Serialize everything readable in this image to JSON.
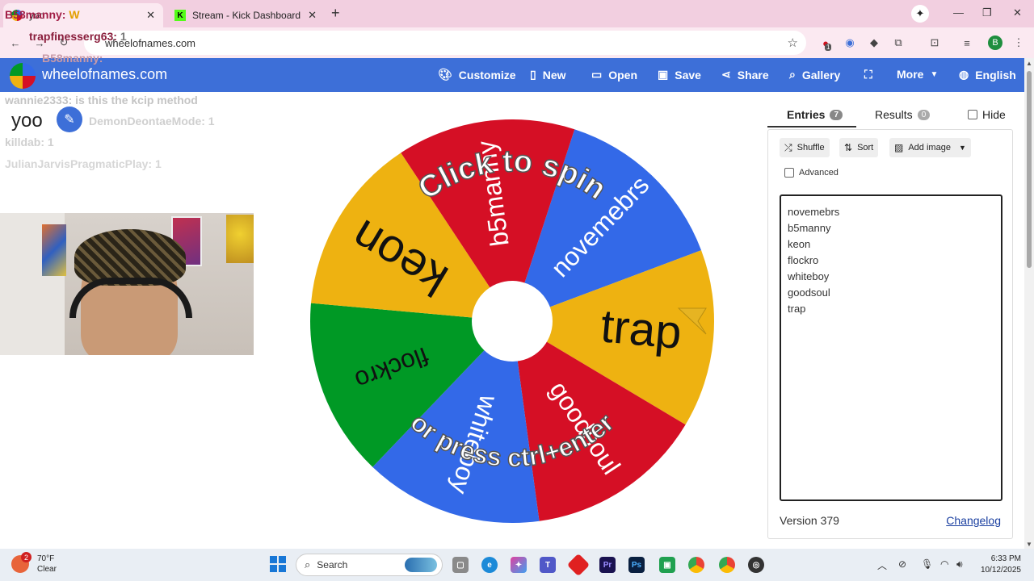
{
  "browser": {
    "tabs": [
      {
        "title": "yoo"
      },
      {
        "title": "Stream - Kick Dashboard"
      }
    ],
    "new_tab": "+",
    "url": "wheelofnames.com",
    "profile_initial": "B",
    "extension_badge": "1",
    "window_controls": {
      "minimize": "—",
      "maximize": "❐",
      "close": "✕"
    }
  },
  "site": {
    "title": "wheelofnames.com",
    "menu": [
      {
        "label": "Customize",
        "icon": "palette-icon"
      },
      {
        "label": "New",
        "icon": "file-icon"
      },
      {
        "label": "Open",
        "icon": "folder-icon"
      },
      {
        "label": "Save",
        "icon": "save-icon"
      },
      {
        "label": "Share",
        "icon": "share-icon"
      },
      {
        "label": "Gallery",
        "icon": "search-icon"
      },
      {
        "label": "More",
        "icon": "chevron-down-icon"
      },
      {
        "label": "English",
        "icon": "globe-icon"
      }
    ]
  },
  "wheel": {
    "slices": [
      {
        "label": "novemebrs",
        "color": "#3369e8"
      },
      {
        "label": "trap",
        "color": "#eeb211"
      },
      {
        "label": "goodsoul",
        "color": "#d50f25"
      },
      {
        "label": "whiteboy",
        "color": "#3369e8"
      },
      {
        "label": "flockro",
        "color": "#009925"
      },
      {
        "label": "keon",
        "color": "#eeb211"
      },
      {
        "label": "b5manny",
        "color": "#d50f25"
      }
    ],
    "prompt_top": "Click to spin",
    "prompt_bottom": "or press ctrl+enter"
  },
  "panel": {
    "tabs": [
      {
        "label": "Entries",
        "count": "7"
      },
      {
        "label": "Results",
        "count": "0"
      }
    ],
    "hide_label": "Hide",
    "buttons": {
      "shuffle": "Shuffle",
      "sort": "Sort",
      "add_image": "Add image"
    },
    "advanced_label": "Advanced",
    "entries": [
      "novemebrs",
      "b5manny",
      "keon",
      "flockro",
      "whiteboy",
      "goodsoul",
      "trap"
    ],
    "version": "Version 379",
    "changelog": "Changelog"
  },
  "overlay": {
    "chat": [
      {
        "user": "B58manny:",
        "msg": "W"
      },
      {
        "user": "trapfinesserg63:",
        "msg": "1"
      },
      {
        "user": "B58manny:",
        "msg": ""
      },
      {
        "user": "wannie2333:",
        "msg": "is this the kcip method"
      },
      {
        "user": "DemonDeontaeMode:",
        "msg": "1"
      },
      {
        "user": "killdab:",
        "msg": "1"
      },
      {
        "user": "JulianJarvisPragmaticPlay:",
        "msg": "1"
      }
    ],
    "caption": "yoo"
  },
  "taskbar": {
    "weather_temp": "70°F",
    "weather_desc": "Clear",
    "weather_badge": "2",
    "search": "Search",
    "time": "6:33 PM",
    "date": "10/12/2025"
  }
}
